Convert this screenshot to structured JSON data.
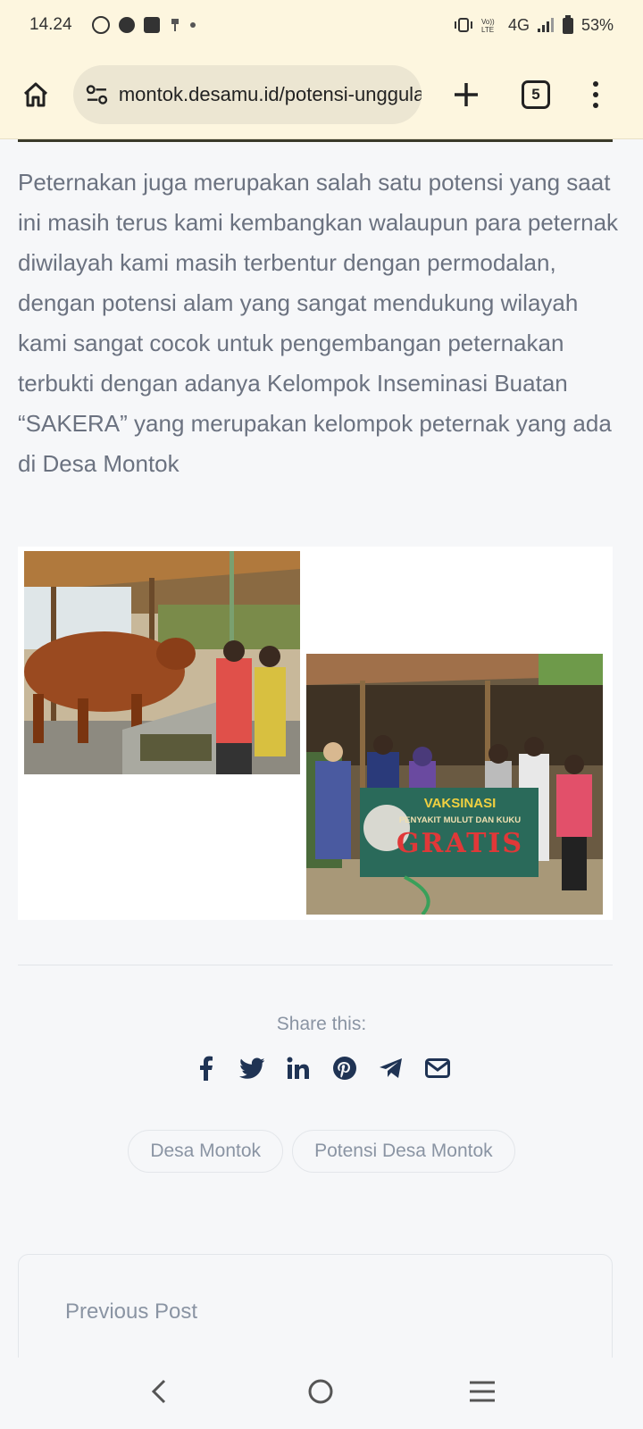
{
  "status_bar": {
    "time": "14.24",
    "network": "4G",
    "battery": "53%"
  },
  "browser": {
    "url": "montok.desamu.id/potensi-unggulan",
    "tab_count": "5"
  },
  "article": {
    "paragraph": "Peternakan juga merupakan salah satu potensi yang saat ini masih terus kami kembangkan walaupun para peternak diwilayah kami masih terbentur dengan permodalan, dengan potensi alam yang sangat mendukung wilayah kami sangat cocok untuk pengembangan peternakan terbukti dengan adanya Kelompok Inseminasi Buatan “SAKERA” yang merupakan kelompok peternak yang ada di Desa Montok",
    "banner": {
      "line1": "VAKSINASI",
      "line2": "PENYAKIT MULUT DAN KUKU",
      "line3": "GRATIS"
    }
  },
  "share": {
    "label": "Share this:",
    "icons": [
      "facebook-icon",
      "twitter-icon",
      "linkedin-icon",
      "pinterest-icon",
      "telegram-icon",
      "email-icon"
    ]
  },
  "tags": [
    "Desa Montok",
    "Potensi Desa Montok"
  ],
  "navigation": {
    "previous_label": "Previous Post"
  },
  "colors": {
    "browser_chrome": "#fdf6df",
    "page_background": "#f6f7f9",
    "text": "#6b7280",
    "share_icon": "#1f3354"
  }
}
